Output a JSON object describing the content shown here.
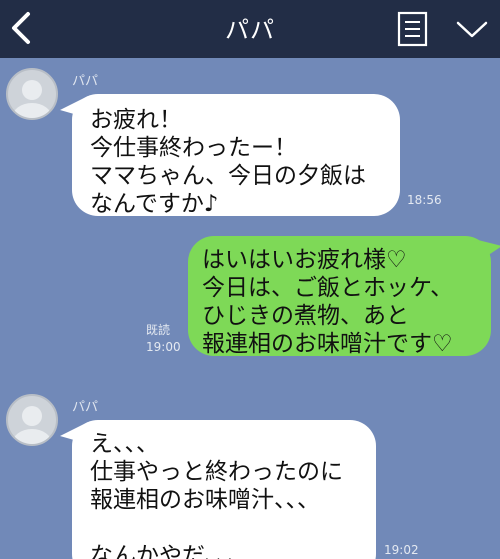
{
  "header": {
    "title": "パパ",
    "back_icon": "chevron-left-icon",
    "menu_icon": "list-icon",
    "more_icon": "chevron-down-icon"
  },
  "messages": [
    {
      "sender": "パパ",
      "text": "お疲れ！\n今仕事終わったー！\nママちゃん、今日の夕飯は\nなんですか♪",
      "time": "18:56"
    },
    {
      "text": "はいはいお疲れ様♡\n今日は、ご飯とホッケ、\nひじきの煮物、あと\n報連相のお味噌汁です♡",
      "read_label": "既読",
      "time": "19:00"
    },
    {
      "sender": "パパ",
      "text": "え、、、\n仕事やっと終わったのに\n報連相のお味噌汁、、、\n\nなんかやだ、、、",
      "time": "19:02"
    }
  ],
  "colors": {
    "background": "#7189b8",
    "header": "#222d46",
    "incoming": "#ffffff",
    "outgoing": "#7ed957"
  }
}
